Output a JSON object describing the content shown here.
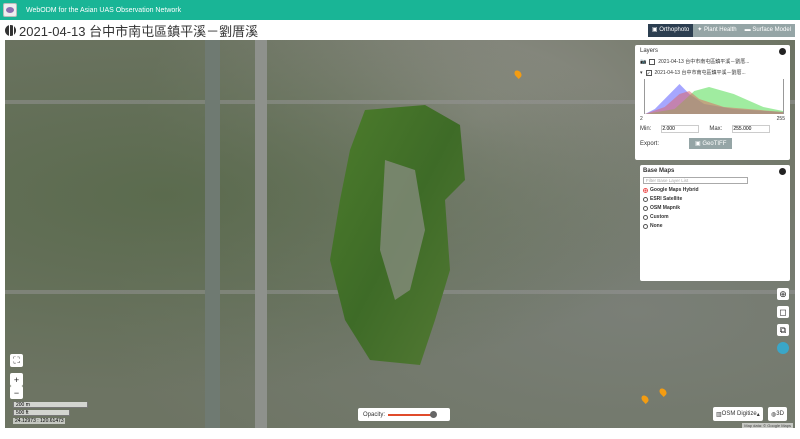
{
  "app": {
    "brand": "WebODM for the Asian UAS Observation Network"
  },
  "page": {
    "title": "2021-04-13 台中市南屯區鎮平溪－劉厝溪"
  },
  "view_tabs": [
    {
      "label": "Orthophoto",
      "active": true
    },
    {
      "label": "Plant Health",
      "active": false
    },
    {
      "label": "Surface Model",
      "active": false
    }
  ],
  "layers": {
    "title": "Layers",
    "items": [
      {
        "label": "2021-04-13 台中市南屯區鎮平溪－劉厝...",
        "checked": false
      },
      {
        "label": "2021-04-13 台中市南屯區鎮平溪－劉厝...",
        "checked": true
      }
    ],
    "hist_min_label": "2",
    "hist_max_label": "255",
    "min_label": "Min:",
    "min_value": "2.000",
    "max_label": "Max:",
    "max_value": "255.000",
    "export_label": "Export:",
    "geotiff_label": "GeoTIFF"
  },
  "basemaps": {
    "title": "Base Maps",
    "filter_placeholder": "Filter Base Layer List",
    "options": [
      {
        "label": "Google Maps Hybrid",
        "selected": true
      },
      {
        "label": "ESRI Satellite",
        "selected": false
      },
      {
        "label": "OSM Mapnik",
        "selected": false
      },
      {
        "label": "Custom",
        "selected": false
      },
      {
        "label": "None",
        "selected": false
      }
    ]
  },
  "map": {
    "scale_m": "200 m",
    "scale_ft": "500 ft",
    "coords": "24.12973 : 120.61473",
    "opacity_label": "Opacity:",
    "opacity": 0.9,
    "osm_digitize_label": "OSM Digitize",
    "threed_label": "3D",
    "attribution": "Map data: © Google Maps"
  },
  "colors": {
    "header": "#19b596",
    "active_tab": "#2c3e50",
    "inactive_tab": "#95a5a6",
    "opacity_slider": "#e04b2b"
  }
}
